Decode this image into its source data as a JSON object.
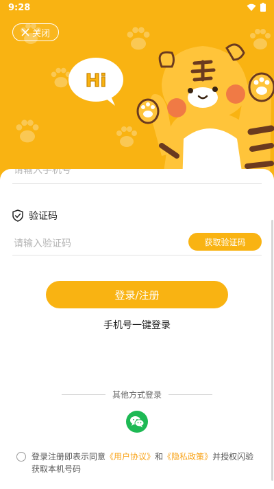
{
  "status_bar": {
    "time": "9:28"
  },
  "header": {
    "close_label": "关闭",
    "bubble_text": "Hi"
  },
  "form": {
    "phone_placeholder": "请输入手机号",
    "code_label": "验证码",
    "code_placeholder": "请输入验证码",
    "get_code_label": "获取验证码",
    "login_button": "登录/注册",
    "one_key_login": "手机号一键登录"
  },
  "other_login": {
    "label": "其他方式登录"
  },
  "agreement": {
    "prefix": "登录注册即表示同意",
    "user_agreement": "《用户协议》",
    "and": "和",
    "privacy_policy": "《隐私政策》",
    "suffix": "并授权闪验获取本机号码"
  },
  "colors": {
    "accent": "#F9B312",
    "wechat": "#1DB954",
    "link": "#F9A41A"
  }
}
